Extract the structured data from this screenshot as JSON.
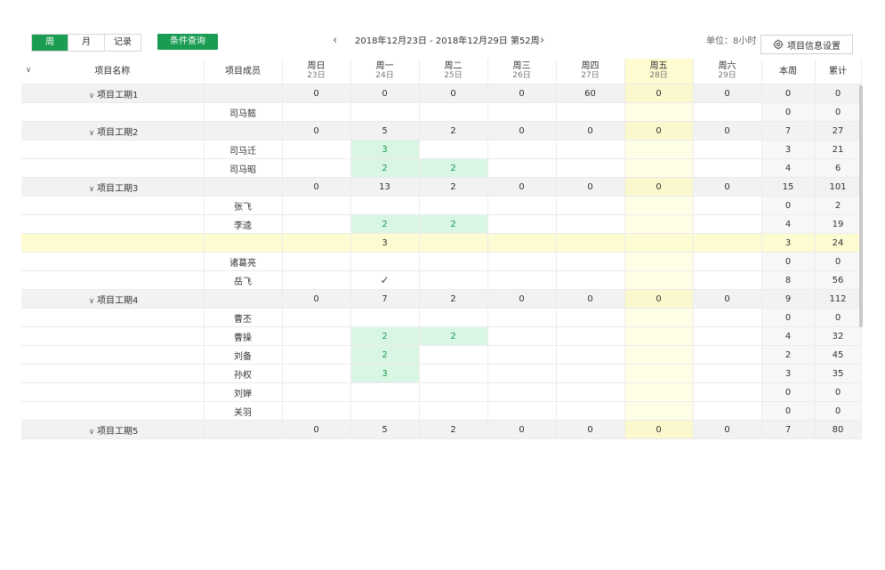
{
  "toolbar": {
    "view_tabs": [
      {
        "label": "周",
        "active": true
      },
      {
        "label": "月",
        "active": false
      },
      {
        "label": "记录",
        "active": false
      }
    ],
    "condition_button": "条件查询",
    "date_range": "2018年12月23日 - 2018年12月29日 第52周",
    "unit_label": "单位：8小时",
    "settings_button": "项目信息设置",
    "colors": {
      "accent": "#1a9c52",
      "today": "#fdfbcf",
      "filled": "#d9f5e3"
    }
  },
  "table": {
    "col_name": "项目名称",
    "col_member": "项目成员",
    "days": [
      {
        "label": "周日",
        "date": "23日"
      },
      {
        "label": "周一",
        "date": "24日"
      },
      {
        "label": "周二",
        "date": "25日"
      },
      {
        "label": "周三",
        "date": "26日"
      },
      {
        "label": "周四",
        "date": "27日"
      },
      {
        "label": "周五",
        "date": "28日"
      },
      {
        "label": "周六",
        "date": "29日"
      }
    ],
    "col_week": "本周",
    "col_total": "累计",
    "rows": [
      {
        "type": "group",
        "name": "项目工期1",
        "member": "",
        "days": [
          "0",
          "0",
          "0",
          "0",
          "60",
          "0",
          "0"
        ],
        "week": "0",
        "total": "0"
      },
      {
        "type": "member",
        "name": "",
        "member": "司马懿",
        "days": [
          "",
          "",
          "",
          "",
          "",
          "",
          ""
        ],
        "week": "0",
        "total": "0"
      },
      {
        "type": "group",
        "name": "项目工期2",
        "member": "",
        "days": [
          "0",
          "5",
          "2",
          "0",
          "0",
          "0",
          "0"
        ],
        "week": "7",
        "total": "27"
      },
      {
        "type": "member",
        "name": "",
        "member": "司马迁",
        "days": [
          "",
          "3",
          "",
          "",
          "",
          "",
          ""
        ],
        "green": [
          1
        ],
        "week": "3",
        "total": "21"
      },
      {
        "type": "member",
        "name": "",
        "member": "司马昭",
        "days": [
          "",
          "2",
          "2",
          "",
          "",
          "",
          ""
        ],
        "green": [
          1,
          2
        ],
        "week": "4",
        "total": "6"
      },
      {
        "type": "group",
        "name": "项目工期3",
        "member": "",
        "days": [
          "0",
          "13",
          "2",
          "0",
          "0",
          "0",
          "0"
        ],
        "week": "15",
        "total": "101"
      },
      {
        "type": "member",
        "name": "",
        "member": "张飞",
        "days": [
          "",
          "",
          "",
          "",
          "",
          "",
          ""
        ],
        "week": "0",
        "total": "2"
      },
      {
        "type": "member",
        "name": "",
        "member": "李逵",
        "days": [
          "",
          "2",
          "2",
          "",
          "",
          "",
          ""
        ],
        "green": [
          1,
          2
        ],
        "week": "4",
        "total": "19"
      },
      {
        "type": "highlight",
        "name": "",
        "member": "",
        "days": [
          "",
          "3",
          "",
          "",
          "",
          "",
          ""
        ],
        "week": "3",
        "total": "24"
      },
      {
        "type": "member",
        "name": "",
        "member": "诸葛亮",
        "days": [
          "",
          "",
          "",
          "",
          "",
          "",
          ""
        ],
        "week": "0",
        "total": "0"
      },
      {
        "type": "member",
        "name": "",
        "member": "岳飞",
        "days": [
          "",
          "✓",
          "",
          "",
          "",
          "",
          ""
        ],
        "check": [
          1
        ],
        "week": "8",
        "total": "56"
      },
      {
        "type": "group",
        "name": "项目工期4",
        "member": "",
        "days": [
          "0",
          "7",
          "2",
          "0",
          "0",
          "0",
          "0"
        ],
        "week": "9",
        "total": "112"
      },
      {
        "type": "member",
        "name": "",
        "member": "曹丕",
        "days": [
          "",
          "",
          "",
          "",
          "",
          "",
          ""
        ],
        "week": "0",
        "total": "0"
      },
      {
        "type": "member",
        "name": "",
        "member": "曹操",
        "days": [
          "",
          "2",
          "2",
          "",
          "",
          "",
          ""
        ],
        "green": [
          1,
          2
        ],
        "week": "4",
        "total": "32"
      },
      {
        "type": "member",
        "name": "",
        "member": "刘备",
        "days": [
          "",
          "2",
          "",
          "",
          "",
          "",
          ""
        ],
        "green": [
          1
        ],
        "week": "2",
        "total": "45"
      },
      {
        "type": "member",
        "name": "",
        "member": "孙权",
        "days": [
          "",
          "3",
          "",
          "",
          "",
          "",
          ""
        ],
        "green": [
          1
        ],
        "week": "3",
        "total": "35"
      },
      {
        "type": "member",
        "name": "",
        "member": "刘婵",
        "days": [
          "",
          "",
          "",
          "",
          "",
          "",
          ""
        ],
        "week": "0",
        "total": "0"
      },
      {
        "type": "member",
        "name": "",
        "member": "关羽",
        "days": [
          "",
          "",
          "",
          "",
          "",
          "",
          ""
        ],
        "week": "0",
        "total": "0"
      },
      {
        "type": "group",
        "name": "项目工期5",
        "member": "",
        "days": [
          "0",
          "5",
          "2",
          "0",
          "0",
          "0",
          "0"
        ],
        "week": "7",
        "total": "80"
      }
    ]
  }
}
